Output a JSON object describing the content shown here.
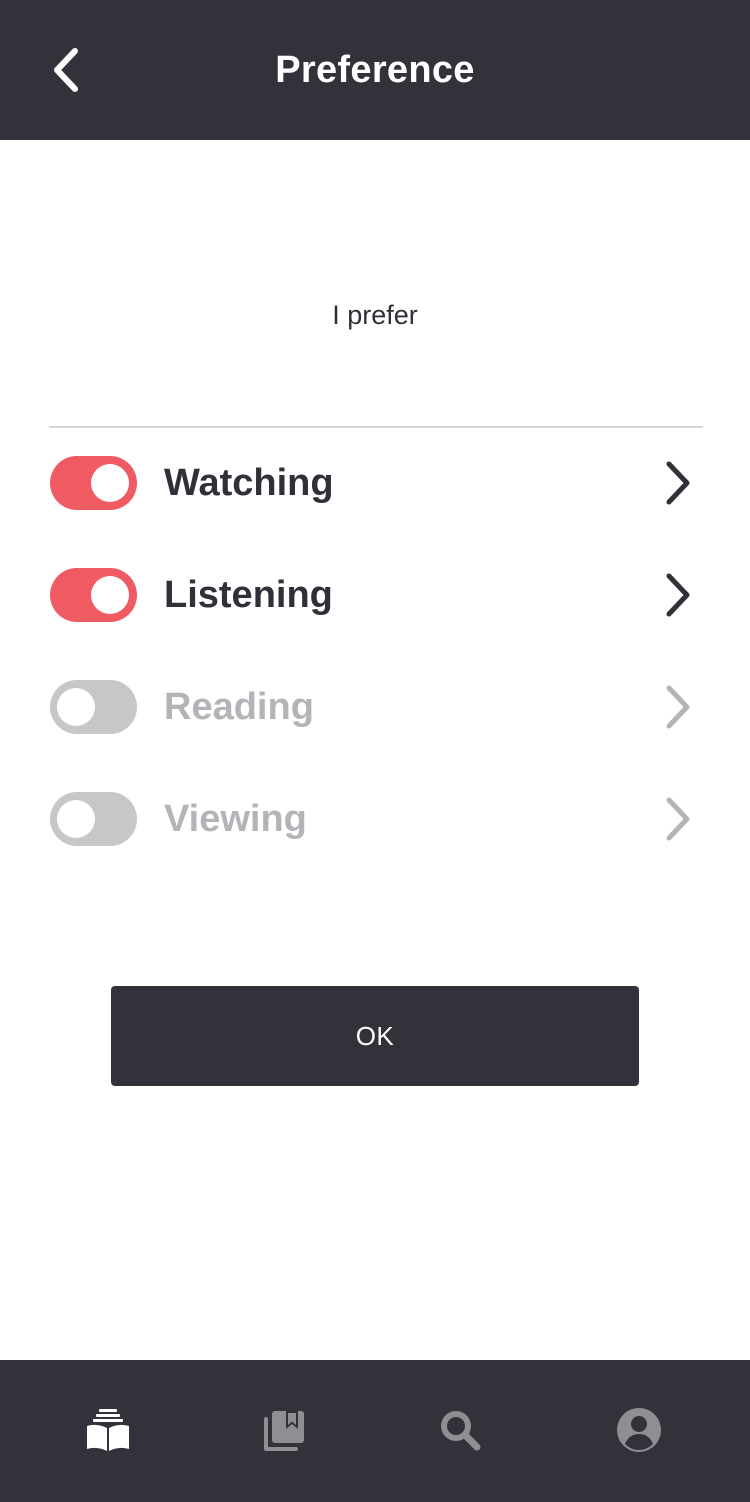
{
  "header": {
    "title": "Preference",
    "back_icon": "chevron-left-icon"
  },
  "prompt": "I prefer",
  "preferences": [
    {
      "label": "Watching",
      "enabled": true
    },
    {
      "label": "Listening",
      "enabled": true
    },
    {
      "label": "Reading",
      "enabled": false
    },
    {
      "label": "Viewing",
      "enabled": false
    }
  ],
  "ok_button": {
    "label": "OK"
  },
  "bottom_nav": {
    "items": [
      {
        "icon": "open-book-icon",
        "active": true
      },
      {
        "icon": "bookmark-library-icon",
        "active": false
      },
      {
        "icon": "search-icon",
        "active": false
      },
      {
        "icon": "user-profile-icon",
        "active": false
      }
    ]
  },
  "colors": {
    "header_bg": "#31323a",
    "toggle_on": "#f05a63",
    "toggle_off": "#c7c7ca",
    "text_active": "#2f3038",
    "text_inactive": "#b4b4b8",
    "nav_active": "#ffffff",
    "nav_inactive": "#8e8e93"
  }
}
